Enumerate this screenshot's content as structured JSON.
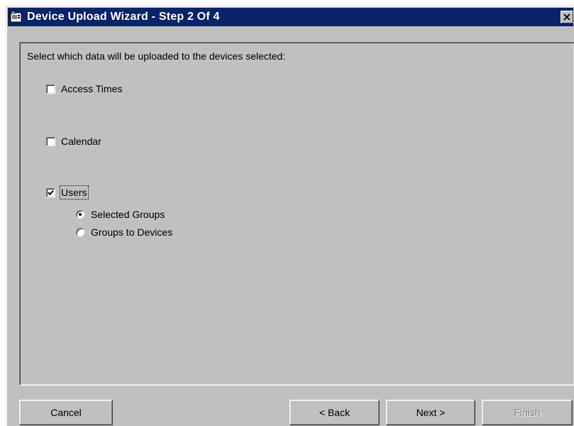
{
  "window": {
    "title": "Device Upload Wizard - Step 2 Of 4"
  },
  "content": {
    "instruction": "Select which data will be uploaded to the devices selected:",
    "options": {
      "access_times": {
        "label": "Access Times",
        "checked": false
      },
      "calendar": {
        "label": "Calendar",
        "checked": false
      },
      "users": {
        "label": "Users",
        "checked": true
      }
    },
    "user_groups": {
      "selected_groups": {
        "label": "Selected Groups",
        "selected": true
      },
      "groups_to_devices": {
        "label": "Groups to Devices",
        "selected": false
      }
    }
  },
  "buttons": {
    "cancel": "Cancel",
    "back": "< Back",
    "next": "Next >",
    "finish": "Finish"
  },
  "icons": {
    "app": "wizard-app-icon",
    "close": "close-icon",
    "check": "checkmark-icon"
  },
  "colors": {
    "titlebar": "#0a246a",
    "face": "#c0c0c0",
    "disabled_text": "#808080"
  }
}
